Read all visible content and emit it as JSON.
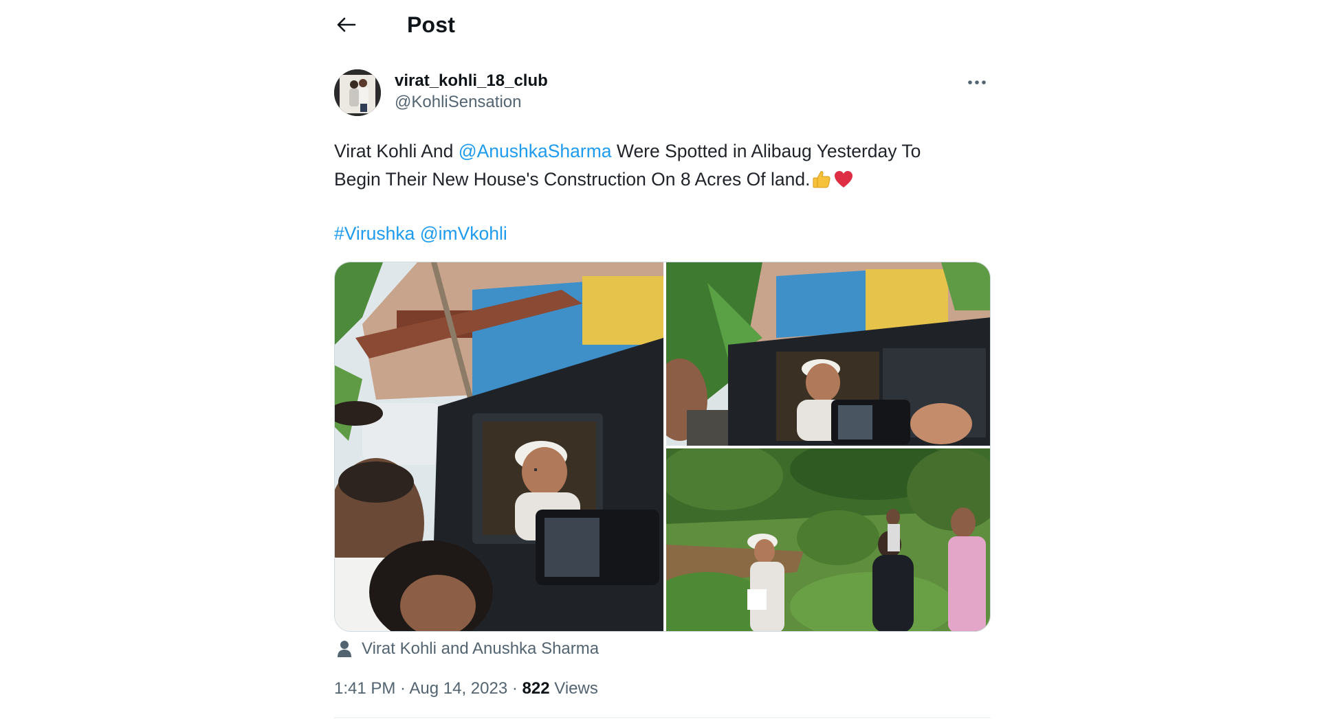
{
  "header": {
    "title": "Post",
    "back_icon": "arrow-left-icon"
  },
  "author": {
    "display_name": "virat_kohli_18_club",
    "handle": "@KohliSensation",
    "more_icon": "more-horizontal-icon"
  },
  "tweet": {
    "line1_prefix": "Virat Kohli And ",
    "mention": "@AnushkaSharma",
    "line1_suffix": " Were Spotted in Alibaug Yesterday To",
    "line2": "Begin Their New House's Construction On 8 Acres Of land.",
    "emojis": [
      "thumbs-up-icon",
      "red-heart-icon"
    ],
    "hashtag": "#Virushka",
    "mention2": "@imVkohli"
  },
  "media": {
    "photos": [
      "photo-car-window",
      "photo-car-selfie",
      "photo-land-walk"
    ]
  },
  "tagged": {
    "icon": "person-icon",
    "text": "Virat Kohli and Anushka Sharma"
  },
  "meta": {
    "time": "1:41 PM",
    "sep1": " · ",
    "date": "Aug 14, 2023",
    "sep2": " · ",
    "views_count": "822",
    "views_label": " Views"
  },
  "colors": {
    "link": "#1d9bf0",
    "secondary_text": "#536471",
    "primary_text": "#0f1419",
    "border": "#cfd9de"
  }
}
